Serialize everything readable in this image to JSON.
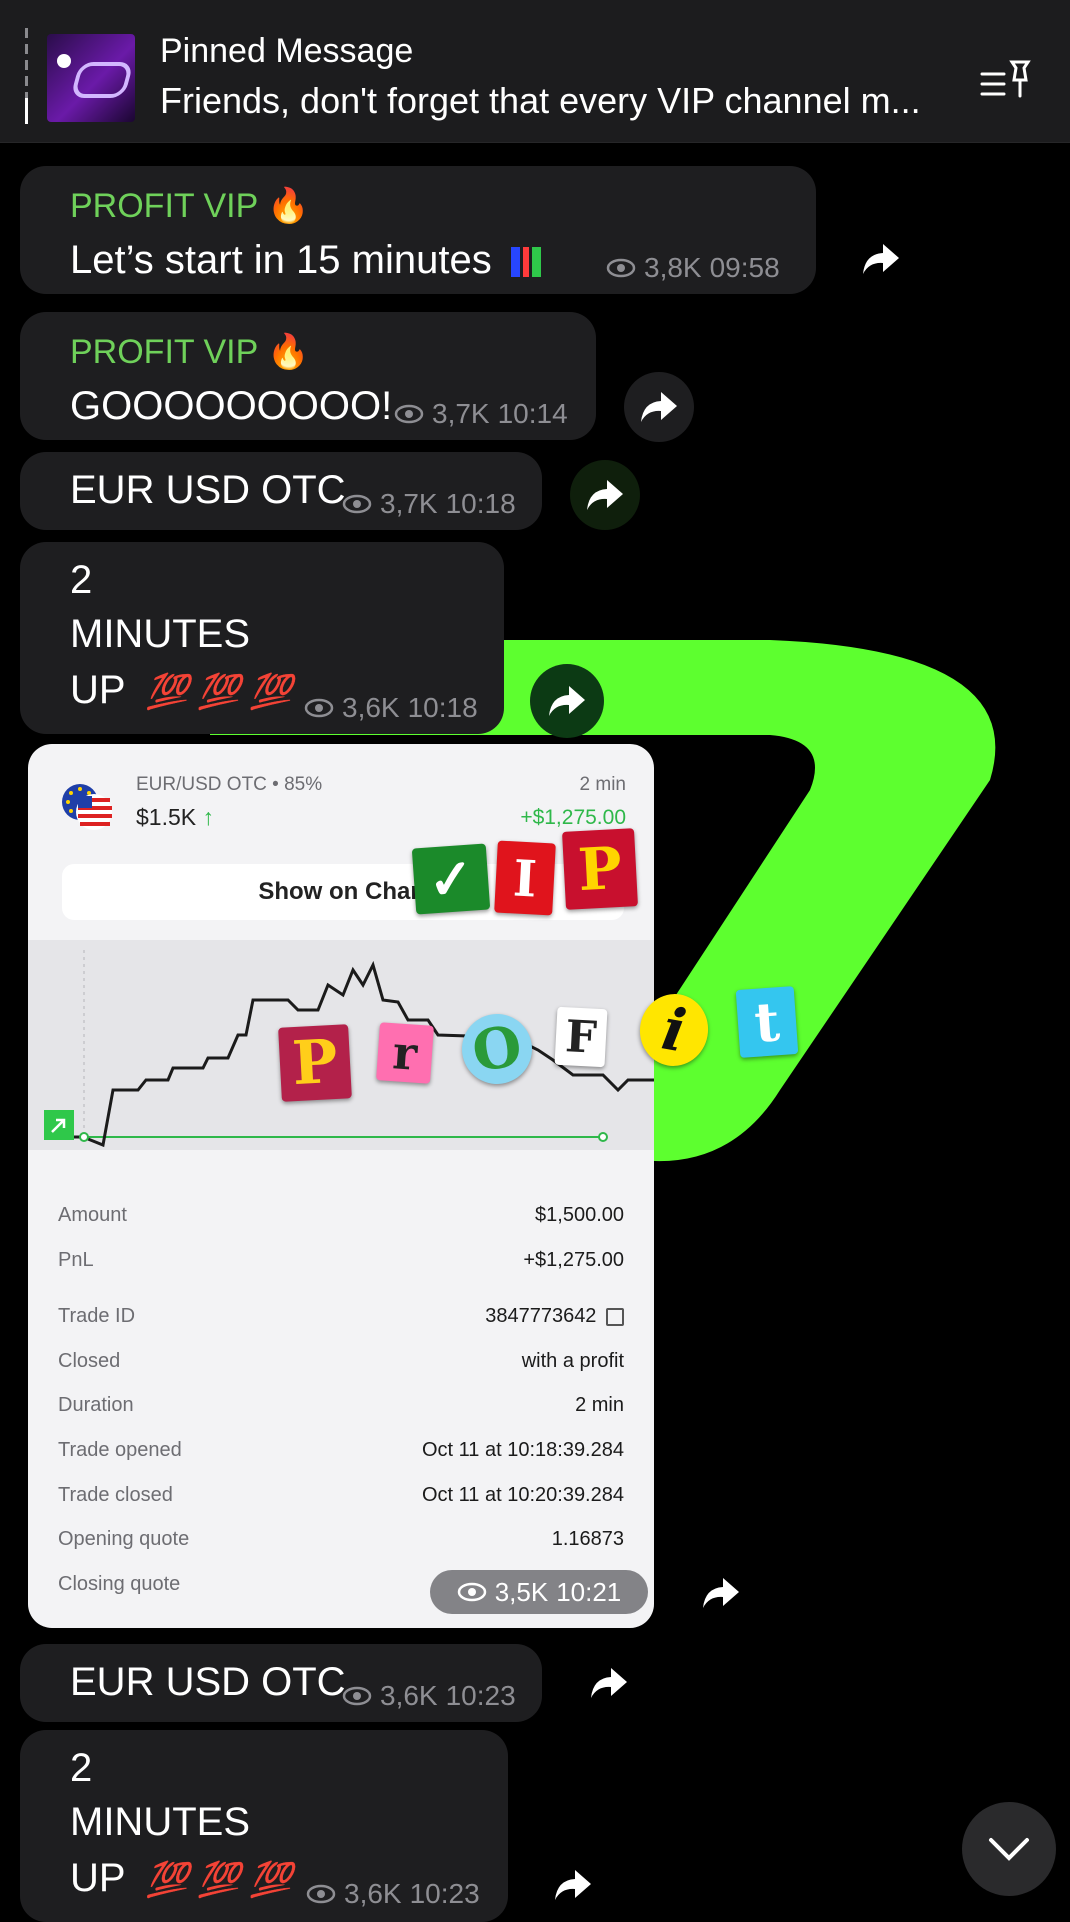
{
  "pinned": {
    "title": "Pinned Message",
    "text": "Friends, don't forget that every VIP channel m..."
  },
  "messages": [
    {
      "sender": "PROFIT VIP 🔥",
      "text": "Let’s start in 15 minutes",
      "views": "3,8K",
      "time": "09:58"
    },
    {
      "sender": "PROFIT VIP 🔥",
      "text": "GOOOOOOOOO!",
      "views": "3,7K",
      "time": "10:14"
    },
    {
      "text": "EUR USD OTC",
      "views": "3,7K",
      "time": "10:18"
    },
    {
      "line1": "2",
      "line2": "MINUTES",
      "line3": "UP",
      "emoji": "💯 💯 💯",
      "views": "3,6K",
      "time": "10:18"
    },
    {
      "text": "EUR USD OTC",
      "views": "3,6K",
      "time": "10:23"
    },
    {
      "line1": "2",
      "line2": "MINUTES",
      "line3": "UP",
      "emoji": "💯 💯 💯",
      "views": "3,6K",
      "time": "10:23"
    }
  ],
  "trade_card": {
    "pair": "EUR/USD OTC • 85%",
    "amount": "$1.5K",
    "arrow": "↑",
    "duration": "2 min",
    "pnl": "+$1,275.00",
    "show_on_chart": "Show on Chart",
    "rows": [
      {
        "label": "Amount",
        "value": "$1,500.00"
      },
      {
        "label": "PnL",
        "value": "+$1,275.00"
      },
      {
        "label": "Trade ID",
        "value": "3847773642"
      },
      {
        "label": "Closed",
        "value": "with a profit"
      },
      {
        "label": "Duration",
        "value": "2 min"
      },
      {
        "label": "Trade opened",
        "value": "Oct 11 at 10:18:39.284"
      },
      {
        "label": "Trade closed",
        "value": "Oct 11 at 10:20:39.284"
      },
      {
        "label": "Opening quote",
        "value": "1.16873"
      },
      {
        "label": "Closing quote",
        "value": ""
      }
    ],
    "views": "3,5K",
    "time": "10:21"
  },
  "sticker_letters": {
    "vip": [
      "✓",
      "I",
      "P"
    ],
    "profit": [
      "P",
      "r",
      "O",
      "F",
      "i",
      "t"
    ]
  },
  "colors": {
    "accent_green": "#6fd15a",
    "neon_green": "#5dff2f",
    "bubble": "#1e1e20",
    "profit_green": "#2fb84a"
  }
}
